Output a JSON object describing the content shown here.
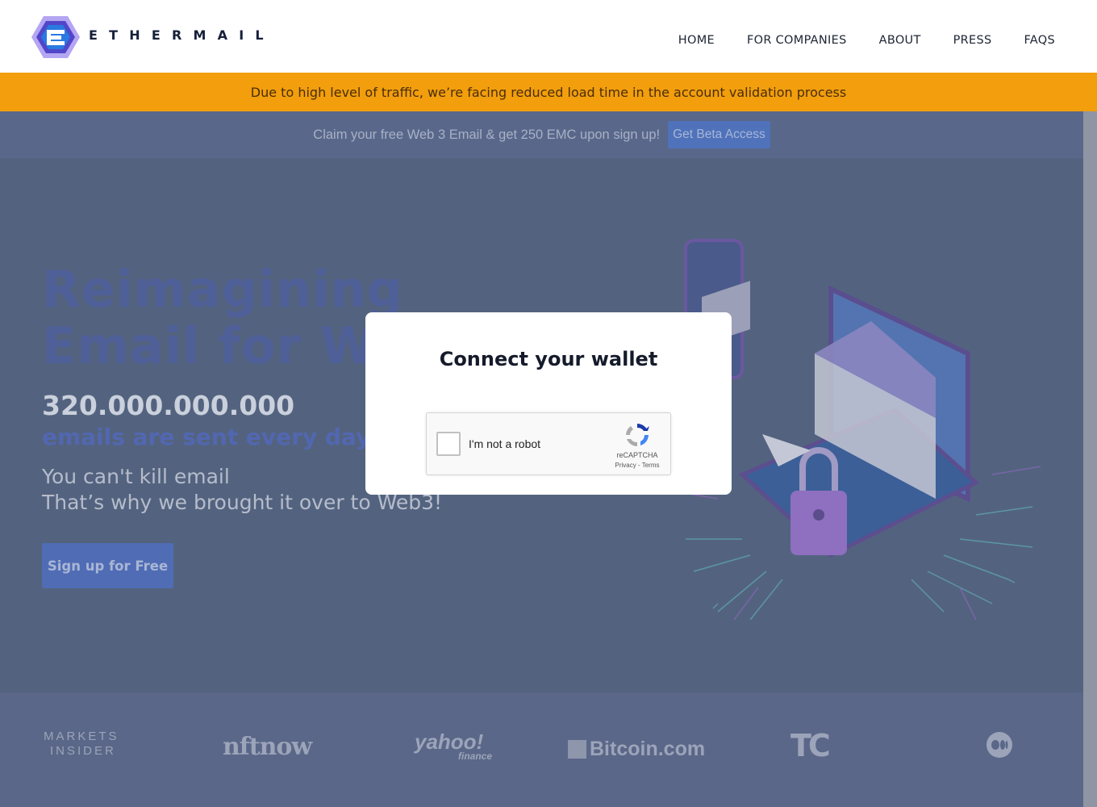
{
  "header": {
    "brand": "ETHERMAIL",
    "nav": [
      "HOME",
      "FOR COMPANIES",
      "ABOUT",
      "PRESS",
      "FAQS"
    ]
  },
  "banner": {
    "warning": "Due to high level of traffic, we’re facing reduced load time in the account validation process"
  },
  "promo": {
    "text": "Claim your free Web 3 Email & get 250 EMC upon sign up!",
    "button": "Get Beta Access"
  },
  "hero": {
    "title_line1": "Reimagining",
    "title_line2": "Email for W",
    "stat": "320.000.000.000",
    "stat_sub": "emails are sent every day",
    "tagline1": "You can't kill email",
    "tagline2": "That’s why we brought it over to Web3!",
    "cta": "Sign up for Free"
  },
  "press_logos": {
    "markets_insider_1": "MARKETS",
    "markets_insider_2": "INSIDER",
    "nftnow": "nftnow",
    "yahoo": "yahoo!",
    "yahoo_sub": "finance",
    "bitcoin": "Bitcoin.com",
    "techcrunch": "TC"
  },
  "modal": {
    "title": "Connect your wallet",
    "captcha_label": "I'm not a robot",
    "captcha_brand": "reCAPTCHA",
    "captcha_links": "Privacy - Terms"
  },
  "colors": {
    "accent": "#f29e0d",
    "overlay": "#53637f",
    "brand": "#7c6ee0"
  }
}
